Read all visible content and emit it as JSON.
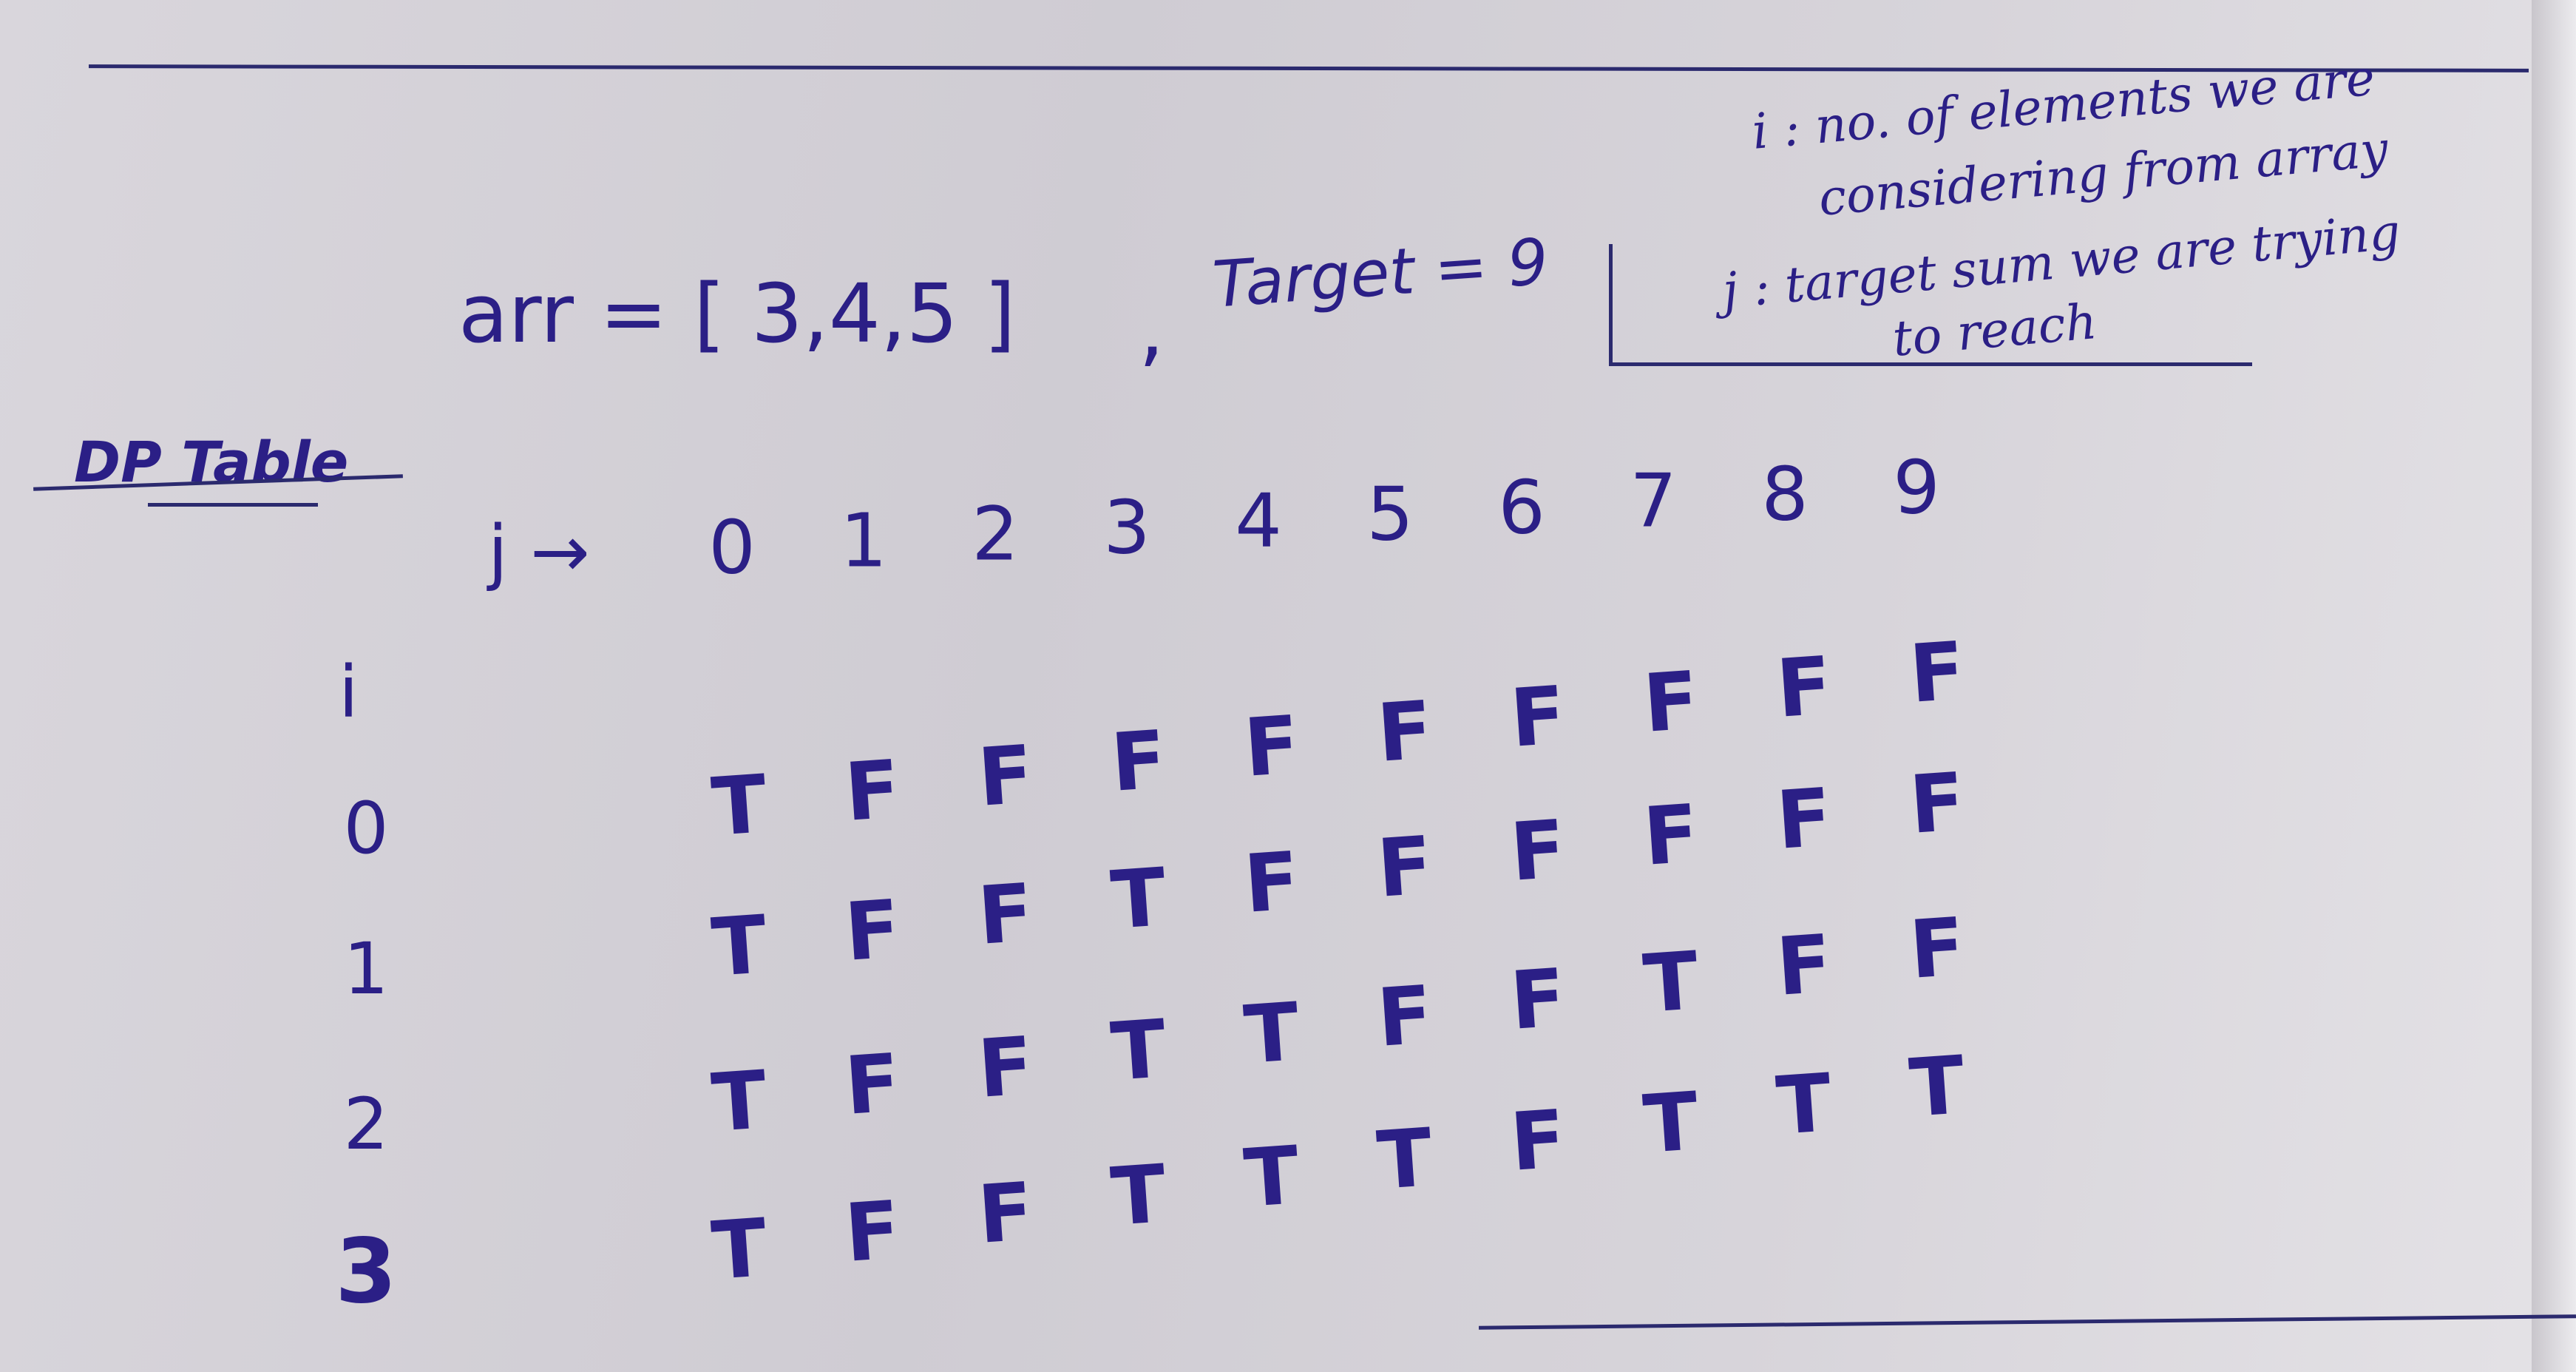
{
  "problem": {
    "array_label": "arr = [ 3,4,5 ]",
    "separator": ",",
    "target_label": "Target = 9"
  },
  "notes": {
    "i_line1": "i : no. of elements we are",
    "i_line2": "considering from array",
    "j_line1": "j : target sum we are trying",
    "j_line2": "to reach"
  },
  "dp_table": {
    "title": "DP Table",
    "column_axis_label": "j →",
    "row_axis_label": "i",
    "columns": [
      "0",
      "1",
      "2",
      "3",
      "4",
      "5",
      "6",
      "7",
      "8",
      "9"
    ],
    "rows": [
      {
        "label": "0",
        "cells": [
          "T",
          "F",
          "F",
          "F",
          "F",
          "F",
          "F",
          "F",
          "F",
          "F"
        ]
      },
      {
        "label": "1",
        "cells": [
          "T",
          "F",
          "F",
          "T",
          "F",
          "F",
          "F",
          "F",
          "F",
          "F"
        ]
      },
      {
        "label": "2",
        "cells": [
          "T",
          "F",
          "F",
          "T",
          "T",
          "F",
          "F",
          "T",
          "F",
          "F"
        ]
      },
      {
        "label": "3",
        "cells": [
          "T",
          "F",
          "F",
          "T",
          "T",
          "T",
          "F",
          "T",
          "T",
          "T"
        ]
      }
    ]
  },
  "colors": {
    "ink": "#2b1f86",
    "paper": "#d6d3d8"
  }
}
